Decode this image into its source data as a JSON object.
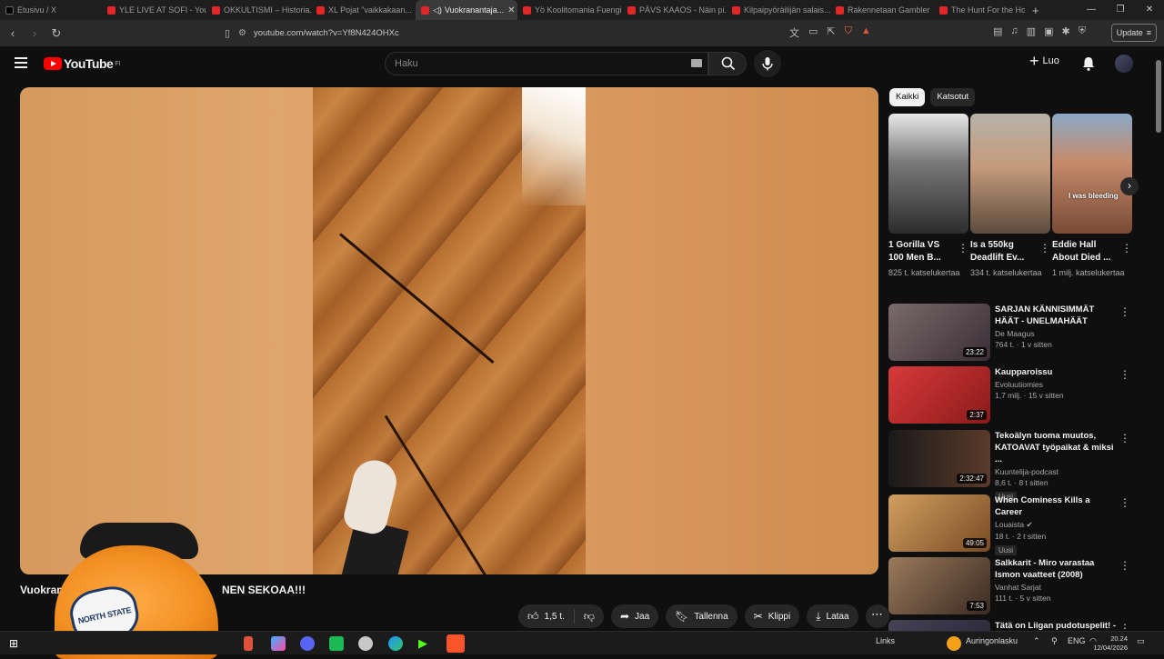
{
  "browser": {
    "tabs": [
      {
        "label": "Etusivu / X",
        "favicon": "x-icon",
        "active": false
      },
      {
        "label": "YLE LIVE AT SOFI - YouTube",
        "favicon": "youtube-icon",
        "active": false
      },
      {
        "label": "OKKULTISMI – Historia...",
        "favicon": "youtube-icon",
        "active": false
      },
      {
        "label": "XL Pojat \"vaikkakaan...",
        "favicon": "youtube-icon",
        "active": false
      },
      {
        "label": "Vuokranantaja...",
        "favicon": "youtube-icon",
        "active": true,
        "audio": true
      },
      {
        "label": "Yö Koolitomania Fuengi...",
        "favicon": "youtube-icon",
        "active": false
      },
      {
        "label": "PÄVS KAAOS - Näin pi...",
        "favicon": "youtube-icon",
        "active": false
      },
      {
        "label": "Kilpaipyöräilijän salais...",
        "favicon": "youtube-icon",
        "active": false
      },
      {
        "label": "Rakennetaan Gambler",
        "favicon": "youtube-icon",
        "active": false
      },
      {
        "label": "The Hunt For the Holo...",
        "favicon": "youtube-icon",
        "active": false
      }
    ],
    "url": "youtube.com/watch?v=Yf8N424OHXc",
    "update_label": "Update"
  },
  "header": {
    "logo_text": "YouTube",
    "logo_region": "FI",
    "search_placeholder": "Haku",
    "create_label": "Luo"
  },
  "video": {
    "title_prefix": "Vuokran",
    "title_suffix": "NEN SEKOAA!!!",
    "cap_patch_text": "NORTH STATE",
    "like_count": "1,5 t.",
    "share_label": "Jaa",
    "save_label": "Tallenna",
    "clip_label": "Klippi",
    "download_label": "Lataa"
  },
  "sidebar": {
    "chips": [
      {
        "label": "Kaikki",
        "active": true
      },
      {
        "label": "Katsotut",
        "active": false
      }
    ],
    "shorts": [
      {
        "title": "1 Gorilla VS 100 Men B...",
        "views": "825 t. katselukertaa",
        "thumb_color": "#6d6d6d"
      },
      {
        "title": "Is a 550kg Deadlift Ev...",
        "views": "334 t. katselukertaa",
        "thumb_color": "#8a7360"
      },
      {
        "title": "Eddie Hall About Died ...",
        "views": "1 milj. katselukertaa",
        "thumb_color": "#9b6a4c",
        "caption": "I was bleeding"
      }
    ],
    "recommendations": [
      {
        "title": "SARJAN KÄNNISIMMÄT HÄÄT - UNELMAHÄÄT",
        "channel": "De Maagus",
        "meta": "764 t. · 1 v sitten",
        "duration": "23:22",
        "badge": "",
        "thumb_color": "#5a4a55"
      },
      {
        "title": "Kaupparoissu",
        "channel": "Evoluutiomies",
        "meta": "1,7 milj. · 15 v sitten",
        "duration": "2:37",
        "badge": "",
        "thumb_color": "#c42a2a"
      },
      {
        "title": "Tekoälyn tuoma muutos, KATOAVAT työpaikat & miksi ...",
        "channel": "Kuuntelija-podcast",
        "meta": "8,6 t. · 8 t sitten",
        "duration": "2:32:47",
        "badge": "Uusi",
        "thumb_color": "#3a2a22"
      },
      {
        "title": "When Cominess Kills a Career",
        "channel": "Louaista",
        "meta": "18 t. · 2 t sitten",
        "duration": "49:05",
        "badge": "Uusi",
        "thumb_color": "#b8742c"
      },
      {
        "title": "Salkkarit - Miro varastaa Ismon vaatteet (2008)",
        "channel": "Vanhat Sarjat",
        "meta": "111 t. · 5 v sitten",
        "duration": "7:53",
        "badge": "",
        "thumb_color": "#6a4a3a"
      },
      {
        "title": "Tätä on Liigan pudotuspelit! -",
        "channel": "",
        "meta": "",
        "duration": "",
        "badge": "",
        "thumb_color": "#333344"
      }
    ]
  },
  "taskbar": {
    "links_label": "Links",
    "weather": "Auringonlasku",
    "language": "ENG",
    "time": "20.24",
    "date": "12/04/2026"
  }
}
